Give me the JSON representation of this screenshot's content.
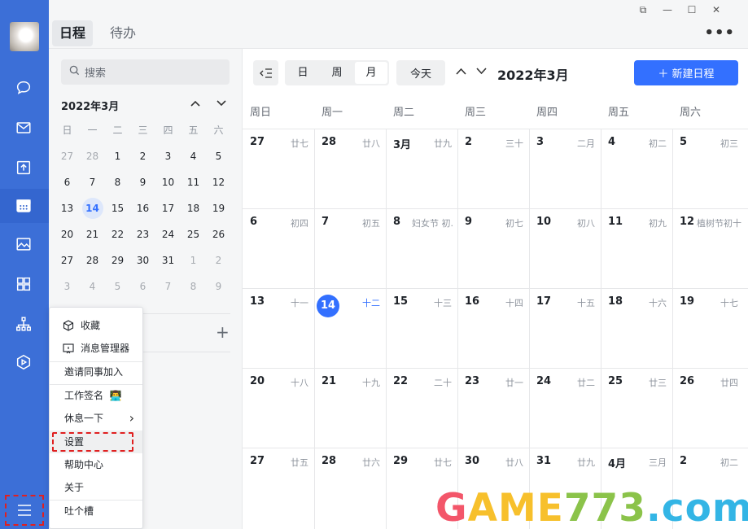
{
  "tabs": {
    "active": "日程",
    "inactive": "待办"
  },
  "window": {
    "restore": "⧉",
    "minimize": "—",
    "maximize": "☐",
    "close": "✕",
    "more": "•••"
  },
  "sidebar": {
    "search_placeholder": "搜索",
    "mini_calendar": {
      "month_label": "2022年3月",
      "prev": "⌃",
      "next": "⌄",
      "weekday_headers": [
        "日",
        "一",
        "二",
        "三",
        "四",
        "五",
        "六"
      ],
      "weeks": [
        [
          "27",
          "28",
          "1",
          "2",
          "3",
          "4",
          "5"
        ],
        [
          "6",
          "7",
          "8",
          "9",
          "10",
          "11",
          "12"
        ],
        [
          "13",
          "14",
          "15",
          "16",
          "17",
          "18",
          "19"
        ],
        [
          "20",
          "21",
          "22",
          "23",
          "24",
          "25",
          "26"
        ],
        [
          "27",
          "28",
          "29",
          "30",
          "31",
          "1",
          "2"
        ],
        [
          "3",
          "4",
          "5",
          "6",
          "7",
          "8",
          "9"
        ]
      ]
    },
    "add": "+"
  },
  "popup_menu": {
    "items": [
      "收藏",
      "消息管理器",
      "邀请同事加入",
      "工作签名",
      "休息一下",
      "设置",
      "帮助中心",
      "关于",
      "吐个槽"
    ],
    "sign_emoji": "👨‍💻",
    "submenu_arrow": "›"
  },
  "toolbar": {
    "view_day": "日",
    "view_week": "周",
    "view_month": "月",
    "today": "今天",
    "prev": "⌃",
    "next": "⌄",
    "current_month": "2022年3月",
    "new_event": "＋ 新建日程"
  },
  "calendar": {
    "weekdays": [
      "周日",
      "周一",
      "周二",
      "周三",
      "周四",
      "周五",
      "周六"
    ],
    "rows": [
      [
        [
          "27",
          "廿七"
        ],
        [
          "28",
          "廿八"
        ],
        [
          "3月",
          "廿九"
        ],
        [
          "2",
          "三十"
        ],
        [
          "3",
          "二月"
        ],
        [
          "4",
          "初二"
        ],
        [
          "5",
          "初三"
        ]
      ],
      [
        [
          "6",
          "初四"
        ],
        [
          "7",
          "初五"
        ],
        [
          "8",
          "妇女节 初..."
        ],
        [
          "9",
          "初七"
        ],
        [
          "10",
          "初八"
        ],
        [
          "11",
          "初九"
        ],
        [
          "12",
          "植树节初十"
        ]
      ],
      [
        [
          "13",
          "十一"
        ],
        [
          "14",
          "十二"
        ],
        [
          "15",
          "十三"
        ],
        [
          "16",
          "十四"
        ],
        [
          "17",
          "十五"
        ],
        [
          "18",
          "十六"
        ],
        [
          "19",
          "十七"
        ]
      ],
      [
        [
          "20",
          "十八"
        ],
        [
          "21",
          "十九"
        ],
        [
          "22",
          "二十"
        ],
        [
          "23",
          "廿一"
        ],
        [
          "24",
          "廿二"
        ],
        [
          "25",
          "廿三"
        ],
        [
          "26",
          "廿四"
        ]
      ],
      [
        [
          "27",
          "廿五"
        ],
        [
          "28",
          "廿六"
        ],
        [
          "29",
          "廿七"
        ],
        [
          "30",
          "廿八"
        ],
        [
          "31",
          "廿九"
        ],
        [
          "4月",
          "三月"
        ],
        [
          "2",
          "初二"
        ]
      ]
    ]
  },
  "watermark": {
    "part1": "G",
    "part2": "AME",
    "part3": "773",
    "part4": ".com"
  }
}
